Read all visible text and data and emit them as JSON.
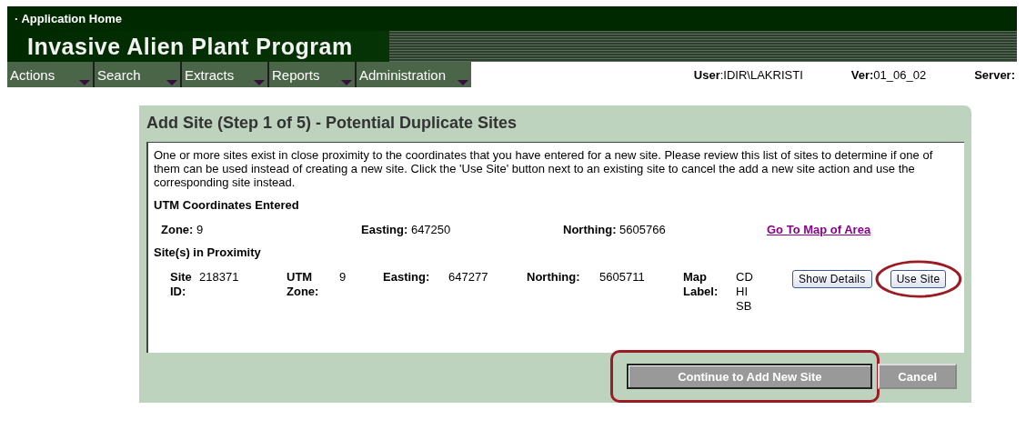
{
  "header": {
    "home_link": "Application Home",
    "bullet": "·",
    "title": "Invasive Alien Plant Program"
  },
  "menu": [
    {
      "label": "Actions"
    },
    {
      "label": "Search"
    },
    {
      "label": "Extracts"
    },
    {
      "label": "Reports"
    },
    {
      "label": "Administration"
    }
  ],
  "user_info": [
    {
      "label": "User",
      "separator": ":",
      "value": "IDIR\\LAKRISTI"
    },
    {
      "label": "Ver:",
      "value": "01_06_02"
    },
    {
      "label": "Server:"
    }
  ],
  "panel": {
    "title": "Add Site (Step 1 of 5) - Potential Duplicate Sites",
    "description": "One or more sites exist in close proximity to the coordinates that you have entered for a new site. Please review this list of sites to determine if one of them can be used instead of creating a new site. Click the 'Use Site' button next to an existing site to cancel the add a new site action and use the corresponding site instead.",
    "entered": {
      "heading": "UTM Coordinates Entered",
      "fields": [
        {
          "label": "Zone:",
          "value": "9"
        },
        {
          "label": "Easting:",
          "value": "647250"
        },
        {
          "label": "Northing:",
          "value": "5605766"
        }
      ],
      "map_link": "Go To Map of Area"
    },
    "proximity": {
      "heading": "Site(s) in Proximity",
      "sites": [
        {
          "fields": [
            {
              "label": "Site ID:",
              "values": [
                "218371"
              ]
            },
            {
              "label": "UTM Zone:",
              "values": [
                "9"
              ]
            },
            {
              "label": "Easting:",
              "values": [
                "647277"
              ]
            },
            {
              "label": "Northing:",
              "values": [
                "5605711"
              ]
            },
            {
              "label": "Map Label:",
              "values": [
                "CD",
                "HI",
                "SB"
              ]
            }
          ],
          "buttons": [
            {
              "label": "Show Details",
              "highlighted": false
            },
            {
              "label": "Use Site",
              "highlighted": true
            }
          ]
        }
      ]
    },
    "footer_buttons": [
      {
        "label": "Continue to Add New Site",
        "highlighted": true
      },
      {
        "label": "Cancel",
        "highlighted": false
      }
    ]
  }
}
